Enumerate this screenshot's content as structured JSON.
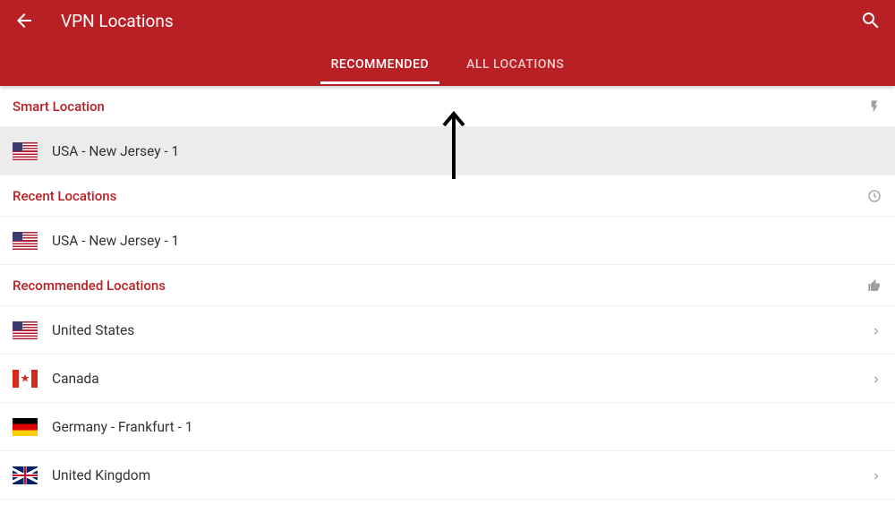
{
  "header": {
    "title": "VPN Locations"
  },
  "tabs": {
    "recommended": "RECOMMENDED",
    "all": "ALL LOCATIONS"
  },
  "sections": {
    "smart": {
      "title": "Smart Location"
    },
    "recent": {
      "title": "Recent Locations"
    },
    "recommended": {
      "title": "Recommended Locations"
    }
  },
  "smart_location": {
    "name": "USA - New Jersey - 1",
    "flag": "us"
  },
  "recent_locations": [
    {
      "name": "USA - New Jersey - 1",
      "flag": "us"
    }
  ],
  "recommended_locations": [
    {
      "name": "United States",
      "flag": "us",
      "expandable": true
    },
    {
      "name": "Canada",
      "flag": "ca",
      "expandable": true
    },
    {
      "name": "Germany - Frankfurt - 1",
      "flag": "de",
      "expandable": false
    },
    {
      "name": "United Kingdom",
      "flag": "uk",
      "expandable": true
    }
  ],
  "colors": {
    "brand": "#b92025",
    "accent_text": "#b92025"
  }
}
